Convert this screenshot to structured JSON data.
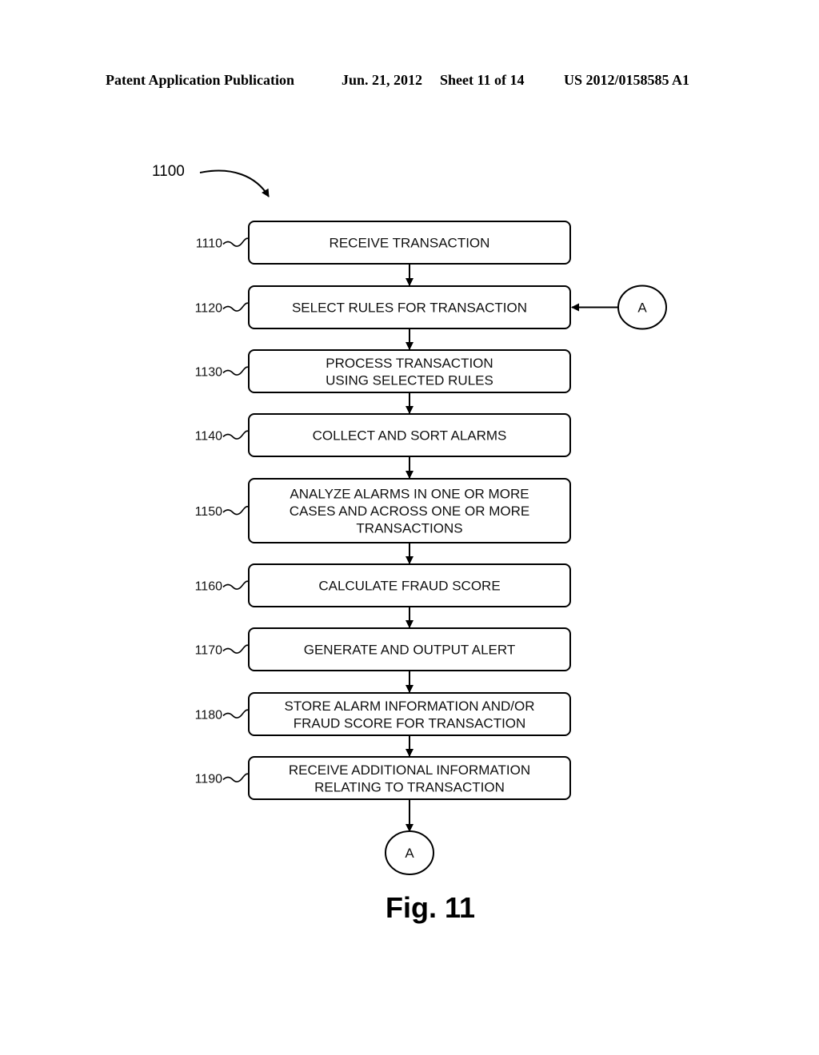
{
  "header": {
    "publication": "Patent Application Publication",
    "date": "Jun. 21, 2012",
    "sheet": "Sheet 11 of 14",
    "number": "US 2012/0158585 A1"
  },
  "diagram": {
    "ref": "1100",
    "steps": [
      {
        "ref": "1110",
        "lines": [
          "RECEIVE TRANSACTION"
        ]
      },
      {
        "ref": "1120",
        "lines": [
          "SELECT RULES FOR TRANSACTION"
        ]
      },
      {
        "ref": "1130",
        "lines": [
          "PROCESS TRANSACTION",
          "USING SELECTED RULES"
        ]
      },
      {
        "ref": "1140",
        "lines": [
          "COLLECT AND SORT ALARMS"
        ]
      },
      {
        "ref": "1150",
        "lines": [
          "ANALYZE ALARMS IN ONE OR MORE",
          "CASES AND ACROSS ONE OR MORE",
          "TRANSACTIONS"
        ]
      },
      {
        "ref": "1160",
        "lines": [
          "CALCULATE FRAUD SCORE"
        ]
      },
      {
        "ref": "1170",
        "lines": [
          "GENERATE AND OUTPUT ALERT"
        ]
      },
      {
        "ref": "1180",
        "lines": [
          "STORE ALARM INFORMATION AND/OR",
          "FRAUD SCORE FOR TRANSACTION"
        ]
      },
      {
        "ref": "1190",
        "lines": [
          "RECEIVE ADDITIONAL INFORMATION",
          "RELATING TO TRANSACTION"
        ]
      }
    ],
    "connector_in": "A",
    "connector_out": "A",
    "figure_label": "Fig. 11"
  }
}
